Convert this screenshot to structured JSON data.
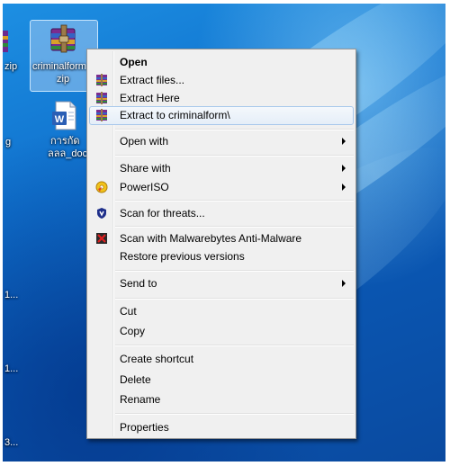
{
  "desktop": {
    "selected_file_label_line1": "criminalform",
    "selected_file_label_line2": "zip",
    "left_zip_label": "zip",
    "doc_file_label_line1": "การกัด",
    "doc_file_label_line2": "ลลล_doc",
    "partial_label_g": "g",
    "partial_label_1": "1...",
    "partial_label_2": "1...",
    "partial_label_3": "3..."
  },
  "context_menu": {
    "open": "Open",
    "extract_files": "Extract files...",
    "extract_here": "Extract Here",
    "extract_to": "Extract to criminalform\\",
    "open_with": "Open with",
    "share_with": "Share with",
    "poweriso": "PowerISO",
    "scan_threats": "Scan for threats...",
    "scan_malwarebytes": "Scan with Malwarebytes Anti-Malware",
    "restore_previous": "Restore previous versions",
    "send_to": "Send to",
    "cut": "Cut",
    "copy": "Copy",
    "create_shortcut": "Create shortcut",
    "delete": "Delete",
    "rename": "Rename",
    "properties": "Properties"
  },
  "colors": {
    "desktop_blue": "#0f6fcc",
    "menu_background": "#f0f0f0",
    "highlight_border": "#a8c8ec"
  }
}
